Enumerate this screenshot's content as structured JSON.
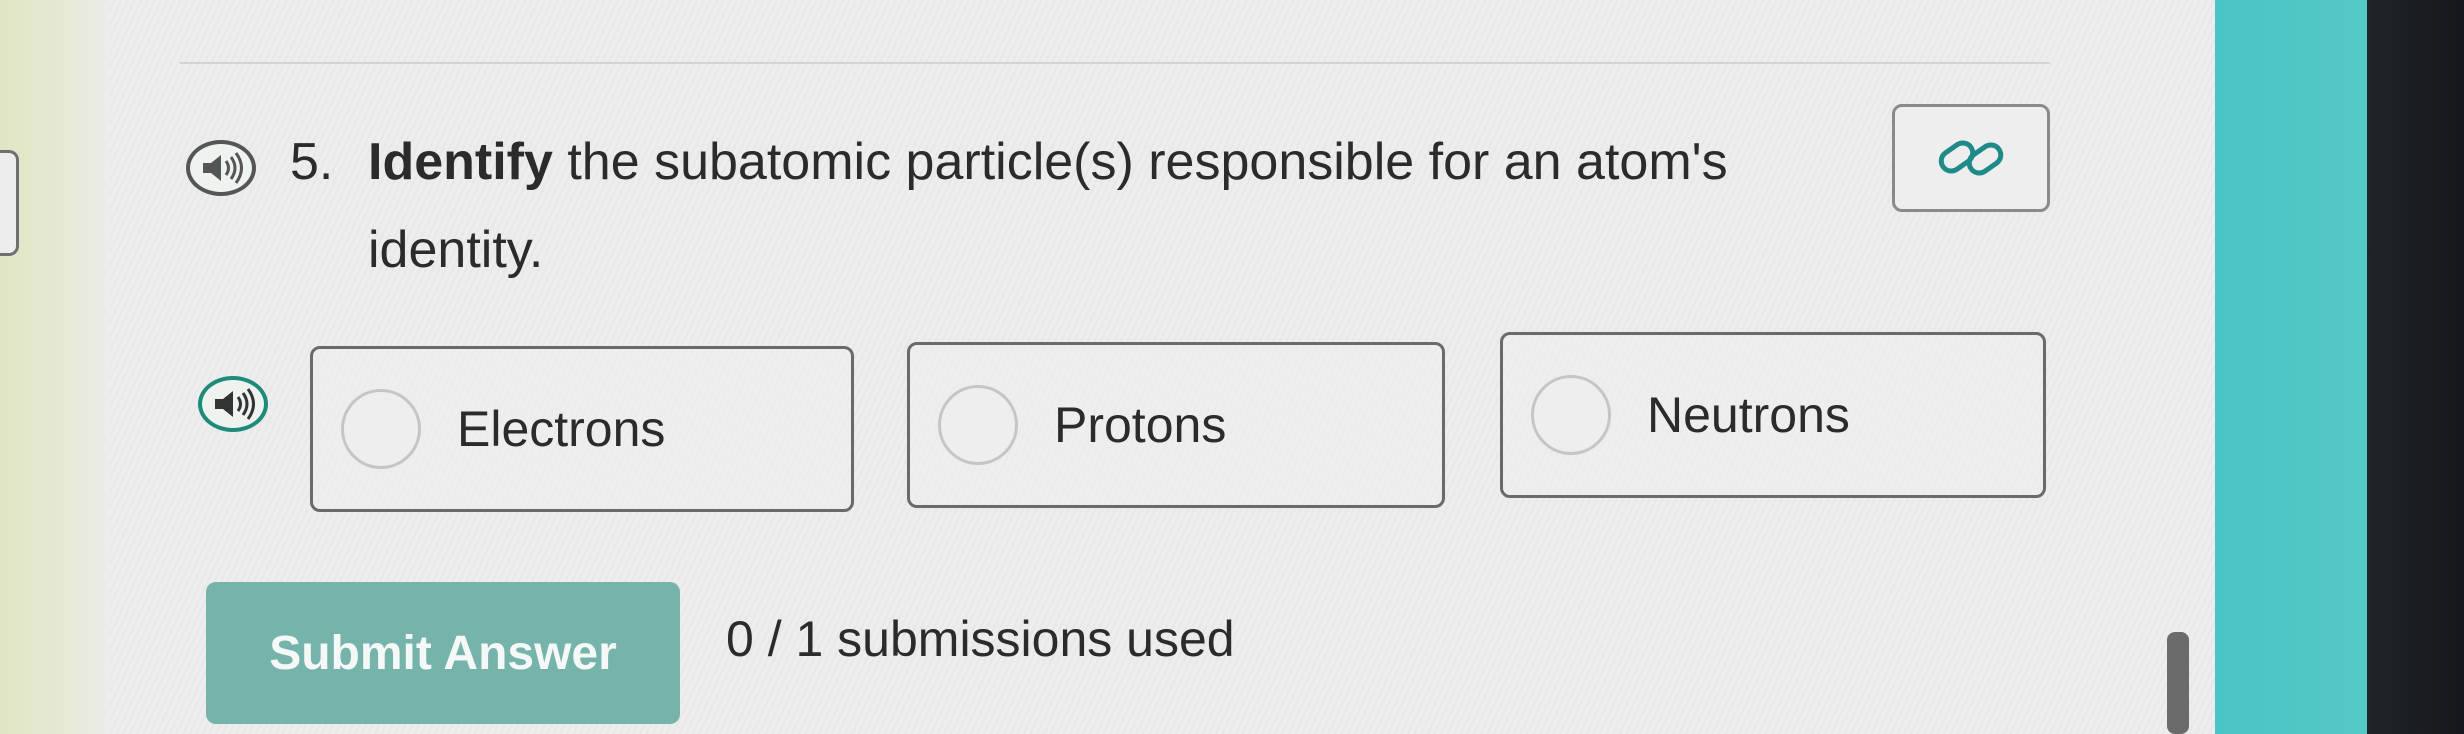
{
  "question": {
    "number": "5.",
    "bold_word": "Identify",
    "line1_rest": " the subatomic particle(s) responsible for an atom's",
    "line2": "identity."
  },
  "options": [
    {
      "label": "Electrons"
    },
    {
      "label": "Protons"
    },
    {
      "label": "Neutrons"
    }
  ],
  "submit": {
    "label": "Submit Answer",
    "submissions_text": "0 / 1 submissions used"
  },
  "icons": {
    "question_audio": "speaker-icon",
    "answers_audio": "speaker-icon",
    "link": "link-icon"
  },
  "colors": {
    "submit_bg": "#76b3aa",
    "teal_accent": "#49c4c4",
    "text": "#2b2b2b"
  }
}
